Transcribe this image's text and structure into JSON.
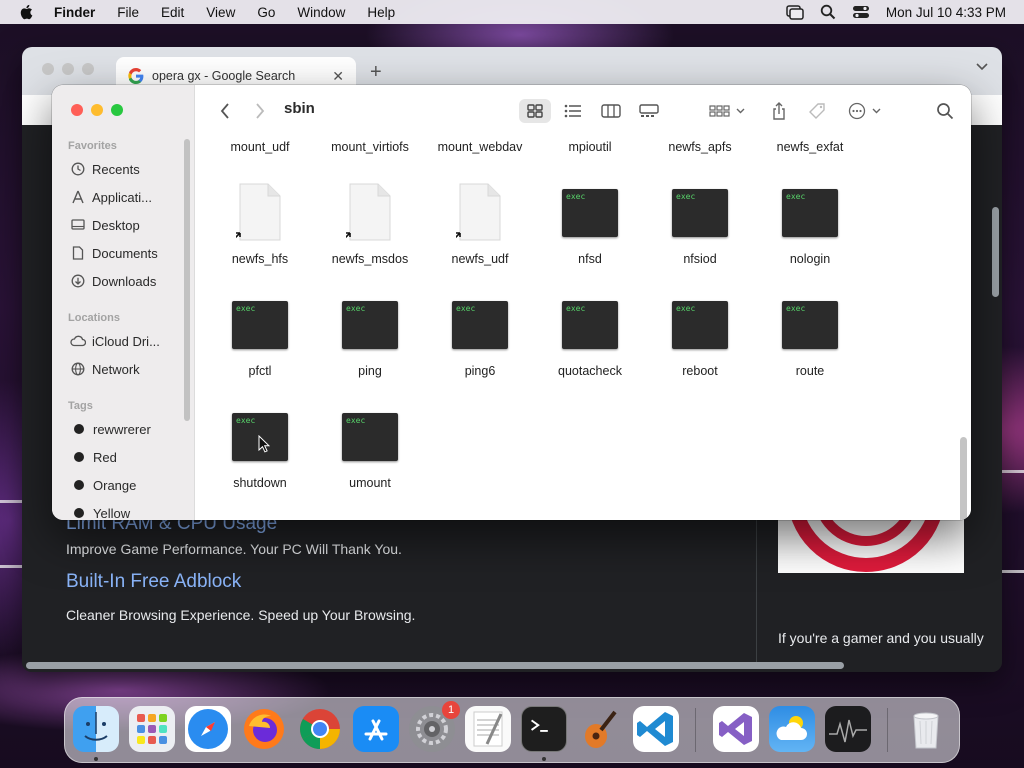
{
  "menubar": {
    "app_name": "Finder",
    "items": [
      "File",
      "Edit",
      "View",
      "Go",
      "Window",
      "Help"
    ],
    "clock": "Mon Jul 10  4:33 PM"
  },
  "browser": {
    "tab_title": "opera gx - Google Search",
    "features": [
      {
        "title": "Limit RAM & CPU Usage",
        "desc": "Improve Game Performance. Your PC Will Thank You."
      },
      {
        "title": "Built-In Free Adblock",
        "desc": "Cleaner Browsing Experience. Speed up Your Browsing."
      }
    ],
    "side_text": "If you're a gamer and you usually"
  },
  "finder": {
    "folder_title": "sbin",
    "sidebar": {
      "favorites_header": "Favorites",
      "favorites": [
        "Recents",
        "Applicati...",
        "Desktop",
        "Documents",
        "Downloads"
      ],
      "locations_header": "Locations",
      "locations": [
        "iCloud Dri...",
        "Network"
      ],
      "tags_header": "Tags",
      "tags": [
        {
          "name": "rewwrerer",
          "color": "#222222"
        },
        {
          "name": "Red",
          "color": "#222222"
        },
        {
          "name": "Orange",
          "color": "#222222"
        },
        {
          "name": "Yellow",
          "color": "#222222"
        }
      ]
    },
    "top_row": [
      "mount_udf",
      "mount_virtiofs",
      "mount_webdav",
      "mpioutil",
      "newfs_apfs",
      "newfs_exfat"
    ],
    "rows": [
      [
        {
          "name": "newfs_hfs",
          "kind": "alias"
        },
        {
          "name": "newfs_msdos",
          "kind": "alias"
        },
        {
          "name": "newfs_udf",
          "kind": "alias"
        },
        {
          "name": "nfsd",
          "kind": "exec"
        },
        {
          "name": "nfsiod",
          "kind": "exec"
        },
        {
          "name": "nologin",
          "kind": "exec"
        }
      ],
      [
        {
          "name": "pfctl",
          "kind": "exec"
        },
        {
          "name": "ping",
          "kind": "exec"
        },
        {
          "name": "ping6",
          "kind": "exec"
        },
        {
          "name": "quotacheck",
          "kind": "exec"
        },
        {
          "name": "reboot",
          "kind": "exec"
        },
        {
          "name": "route",
          "kind": "exec"
        }
      ],
      [
        {
          "name": "shutdown",
          "kind": "exec"
        },
        {
          "name": "umount",
          "kind": "exec"
        }
      ]
    ],
    "exec_label": "exec"
  },
  "dock": {
    "apps": [
      "Finder",
      "Launchpad",
      "Safari",
      "Firefox",
      "Chrome",
      "App Store",
      "System Settings",
      "TextEdit",
      "Terminal",
      "GarageBand",
      "Visual Studio Code",
      "Visual Studio",
      "Weather",
      "Activity Monitor",
      "Trash"
    ],
    "settings_badge": "1"
  },
  "colors": {
    "exec_text": "#58d36a",
    "close": "#ff5f57",
    "minimize": "#febc2e",
    "zoom": "#28c840",
    "link": "#8ab4f8"
  }
}
